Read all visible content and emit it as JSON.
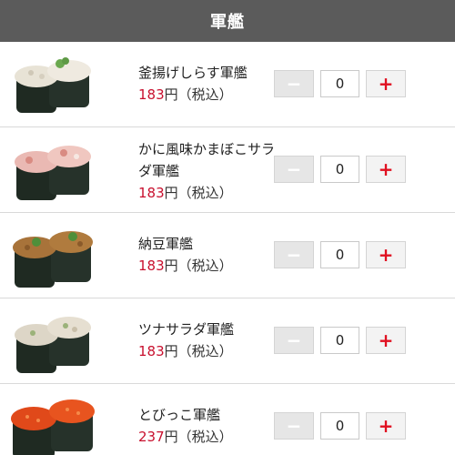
{
  "header": {
    "title": "軍艦"
  },
  "items": [
    {
      "name": "釜揚げしらす軍艦",
      "price": "183",
      "price_suffix": "円（税込）",
      "qty": "0",
      "minus": "−",
      "plus": "+",
      "image": "shirasu-gunkan",
      "topping_color": "#e8e3d6"
    },
    {
      "name": "かに風味かまぼこサラダ軍艦",
      "price": "183",
      "price_suffix": "円（税込）",
      "qty": "0",
      "minus": "−",
      "plus": "+",
      "image": "kani-salad-gunkan",
      "topping_color": "#eab9b3"
    },
    {
      "name": "納豆軍艦",
      "price": "183",
      "price_suffix": "円（税込）",
      "qty": "0",
      "minus": "−",
      "plus": "+",
      "image": "natto-gunkan",
      "topping_color": "#a8733a"
    },
    {
      "name": "ツナサラダ軍艦",
      "price": "183",
      "price_suffix": "円（税込）",
      "qty": "0",
      "minus": "−",
      "plus": "+",
      "image": "tuna-salad-gunkan",
      "topping_color": "#ddd6c7"
    },
    {
      "name": "とびっこ軍艦",
      "price": "237",
      "price_suffix": "円（税込）",
      "qty": "0",
      "minus": "−",
      "plus": "+",
      "image": "tobikko-gunkan",
      "topping_color": "#e0491a"
    }
  ],
  "colors": {
    "header_bg": "#5b5b5b",
    "price_red": "#c8102e",
    "plus_red": "#e01020",
    "nori": "#1f2a22"
  }
}
